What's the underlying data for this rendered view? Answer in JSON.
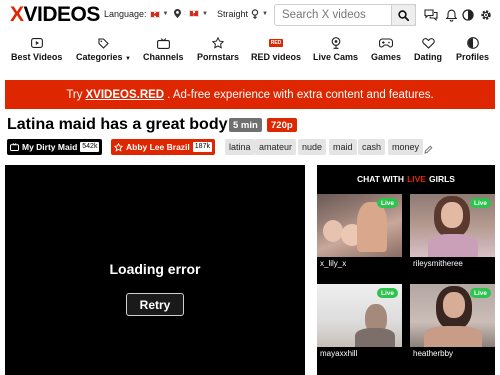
{
  "header": {
    "logo_x": "X",
    "logo_rest": "VIDEOS",
    "language_label": "Language:",
    "orientation_label": "Straight",
    "search_placeholder": "Search X videos"
  },
  "nav": [
    {
      "label": "Best Videos",
      "icon": "play-square-icon"
    },
    {
      "label": "Categories",
      "icon": "tags-icon"
    },
    {
      "label": "Channels",
      "icon": "tv-icon"
    },
    {
      "label": "Pornstars",
      "icon": "star-icon"
    },
    {
      "label": "RED videos",
      "icon": "red-badge-icon",
      "badge": "RED"
    },
    {
      "label": "Live Cams",
      "icon": "webcam-icon"
    },
    {
      "label": "Games",
      "icon": "gamepad-icon"
    },
    {
      "label": "Dating",
      "icon": "hearts-icon"
    },
    {
      "label": "Profiles",
      "icon": "user-icon"
    }
  ],
  "banner": {
    "prefix": "Try",
    "link": "XVIDEOS.RED",
    "suffix": ". Ad-free experience with extra content and features."
  },
  "video": {
    "title": "Latina maid has a great body",
    "duration": "5 min",
    "quality": "720p"
  },
  "uploader": {
    "name": "My Dirty Maid",
    "count": "542k"
  },
  "pornstar": {
    "name": "Abby Lee Brazil",
    "count": "187k"
  },
  "tags": [
    "latina",
    "amateur",
    "nude",
    "maid",
    "cash",
    "money"
  ],
  "player": {
    "error_text": "Loading error",
    "retry_label": "Retry"
  },
  "live": {
    "head_prefix": "CHAT WITH",
    "head_red": "LIVE",
    "head_suffix": "GIRLS",
    "badge": "Live",
    "cams": [
      {
        "name": "x_lily_x"
      },
      {
        "name": "rileysmitheree"
      },
      {
        "name": "mayaxxhill"
      },
      {
        "name": "heatherbby"
      }
    ]
  },
  "colors": {
    "brand_red": "#de2600",
    "live_green": "#2ec24f"
  }
}
